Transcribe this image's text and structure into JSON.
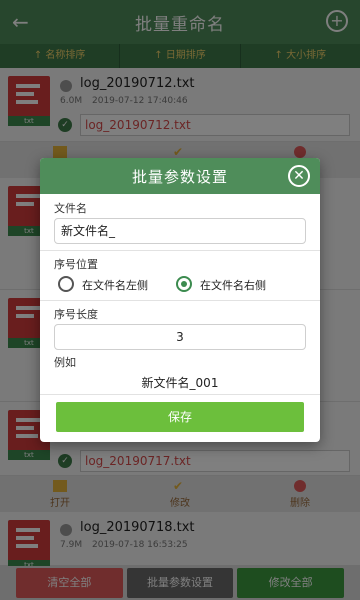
{
  "app": {
    "title": "批量重命名"
  },
  "sort_tabs": [
    "↑ 名称排序",
    "↑ 日期排序",
    "↑ 大小排序"
  ],
  "list": {
    "items": [
      {
        "name": "log_20190712.txt",
        "size": "6.0M",
        "date": "2019-07-12 17:40:46",
        "new_name": "log_20190712.txt",
        "thumb_tag": "txt"
      },
      {
        "name": "",
        "size": "",
        "date": "",
        "new_name": "",
        "thumb_tag": "txt"
      },
      {
        "name": "",
        "size": "",
        "date": "",
        "new_name": "",
        "thumb_tag": "txt"
      },
      {
        "name": "",
        "size": "",
        "date": "",
        "new_name": "log_20190717.txt",
        "thumb_tag": "txt"
      },
      {
        "name": "log_20190718.txt",
        "size": "7.9M",
        "date": "2019-07-18 16:53:25",
        "new_name": "",
        "thumb_tag": "txt"
      }
    ],
    "actions": {
      "open": "打开",
      "modify": "修改",
      "delete": "删除"
    }
  },
  "bottom": {
    "clear_all": "清空全部",
    "batch_settings": "批量参数设置",
    "modify_all": "修改全部"
  },
  "dialog": {
    "title": "批量参数设置",
    "filename_label": "文件名",
    "filename_value": "新文件名_",
    "position_label": "序号位置",
    "option_left": "在文件名左侧",
    "option_right": "在文件名右侧",
    "length_label": "序号长度",
    "length_value": "3",
    "example_label": "例如",
    "example_value": "新文件名_001",
    "save": "保存"
  },
  "colors": {
    "primary": "#4f8d5a",
    "save": "#6cbf3c",
    "danger": "#e15b5b",
    "neutral": "#6b6b6b",
    "go": "#3c9b3f"
  }
}
